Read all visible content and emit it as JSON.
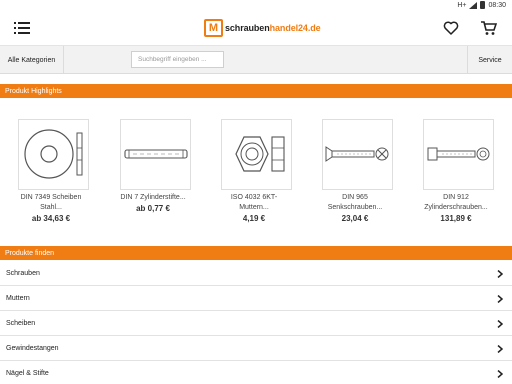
{
  "status_bar": {
    "network": "H+",
    "time": "08:30"
  },
  "app_bar": {
    "menu_icon": "menu-icon",
    "logo": {
      "mark": "M",
      "text_prefix": "schrauben",
      "text_brand": "handel24",
      "text_suffix": ".de"
    },
    "wishlist_icon": "heart-icon",
    "cart_icon": "cart-icon"
  },
  "toolbar": {
    "categories_label": "Alle Kategorien",
    "search_placeholder": "Suchbegriff eingeben ...",
    "service_label": "Service"
  },
  "highlights": {
    "title": "Produkt Highlights",
    "products": [
      {
        "name": "DIN 7349 Scheiben\nStahl...",
        "price": "ab 34,63 €",
        "icon": "washer-icon"
      },
      {
        "name": "DIN 7 Zylinderstifte...",
        "price": "ab 0,77 €",
        "icon": "cylinder-pin-icon"
      },
      {
        "name": "ISO 4032 6KT-\nMuttern...",
        "price": "4,19 €",
        "icon": "hex-nut-icon"
      },
      {
        "name": "DIN 965\nSenkschrauben...",
        "price": "23,04 €",
        "icon": "countersunk-screw-icon"
      },
      {
        "name": "DIN 912\nZylinderschrauben...",
        "price": "131,89 €",
        "icon": "socket-head-screw-icon"
      }
    ]
  },
  "finder": {
    "title": "Produkte finden",
    "items": [
      {
        "label": "Schrauben"
      },
      {
        "label": "Muttern"
      },
      {
        "label": "Scheiben"
      },
      {
        "label": "Gewindestangen"
      },
      {
        "label": "Nägel & Stifte"
      }
    ]
  },
  "colors": {
    "accent": "#f07d13",
    "toolbar_bg": "#f2f2f2"
  }
}
